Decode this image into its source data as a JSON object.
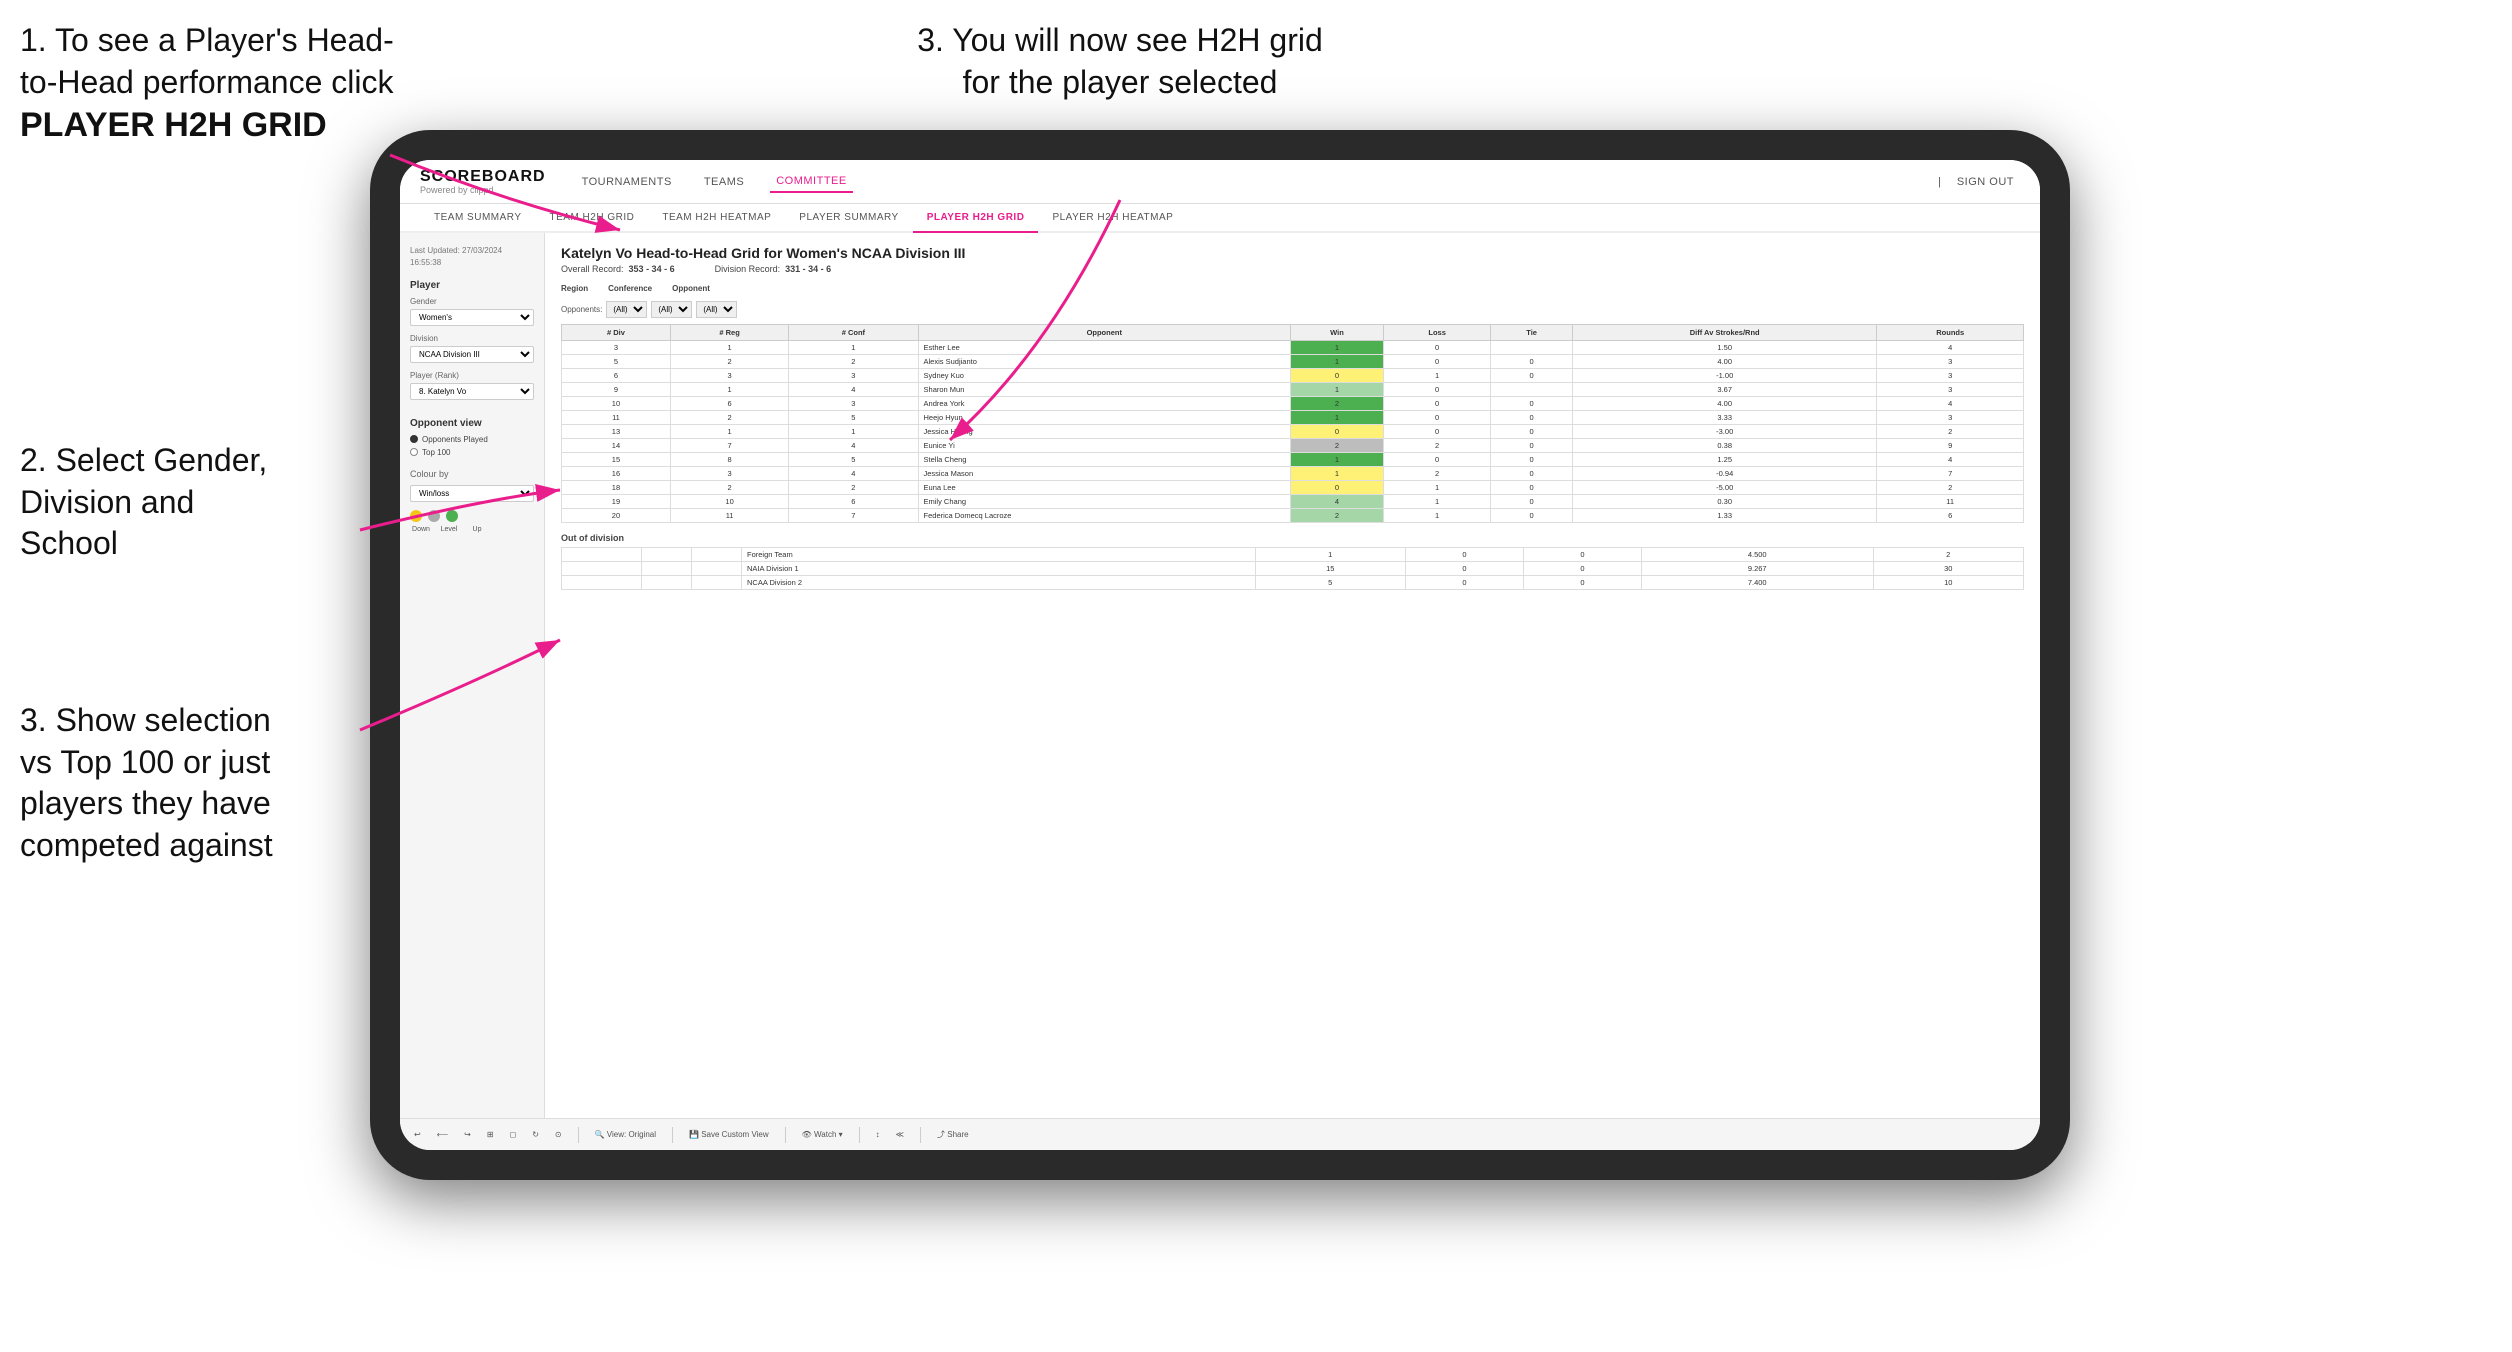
{
  "instructions": {
    "top_left_line1": "1. To see a Player's Head-",
    "top_left_line2": "to-Head performance click",
    "top_left_bold": "PLAYER H2H GRID",
    "top_right": "3. You will now see H2H grid\nfor the player selected",
    "mid_left_label": "2. Select Gender,\nDivision and\nSchool",
    "bottom_left_label": "3. Show selection\nvs Top 100 or just\nplayers they have\ncompeted against"
  },
  "header": {
    "logo": "SCOREBOARD",
    "logo_sub": "Powered by clippd",
    "nav": [
      "TOURNAMENTS",
      "TEAMS",
      "COMMITTEE"
    ],
    "active_nav": "COMMITTEE",
    "sign_out": "Sign out"
  },
  "sub_nav": {
    "items": [
      "TEAM SUMMARY",
      "TEAM H2H GRID",
      "TEAM H2H HEATMAP",
      "PLAYER SUMMARY",
      "PLAYER H2H GRID",
      "PLAYER H2H HEATMAP"
    ],
    "active": "PLAYER H2H GRID"
  },
  "sidebar": {
    "timestamp": "Last Updated: 27/03/2024\n16:55:38",
    "player_section": "Player",
    "gender_label": "Gender",
    "gender_value": "Women's",
    "division_label": "Division",
    "division_value": "NCAA Division III",
    "player_rank_label": "Player (Rank)",
    "player_rank_value": "8. Katelyn Vo",
    "opponent_view": "Opponent view",
    "radio_options": [
      "Opponents Played",
      "Top 100"
    ],
    "selected_radio": "Opponents Played",
    "colour_by": "Colour by",
    "colour_by_value": "Win/loss",
    "colour_labels": [
      "Down",
      "Level",
      "Up"
    ]
  },
  "grid": {
    "title": "Katelyn Vo Head-to-Head Grid for Women's NCAA Division III",
    "overall_record_label": "Overall Record:",
    "overall_record_value": "353 - 34 - 6",
    "division_record_label": "Division Record:",
    "division_record_value": "331 - 34 - 6",
    "region_filter_label": "Region",
    "conference_filter_label": "Conference",
    "opponent_filter_label": "Opponent",
    "opponents_label": "Opponents:",
    "filter_all": "(All)",
    "columns": [
      "# Div",
      "# Reg",
      "# Conf",
      "Opponent",
      "Win",
      "Loss",
      "Tie",
      "Diff Av Strokes/Rnd",
      "Rounds"
    ],
    "rows": [
      {
        "div": "3",
        "reg": "1",
        "conf": "1",
        "opponent": "Esther Lee",
        "win": "1",
        "loss": "0",
        "tie": "",
        "diff": "1.50",
        "rounds": "4",
        "win_color": "green"
      },
      {
        "div": "5",
        "reg": "2",
        "conf": "2",
        "opponent": "Alexis Sudjianto",
        "win": "1",
        "loss": "0",
        "tie": "0",
        "diff": "4.00",
        "rounds": "3",
        "win_color": "green"
      },
      {
        "div": "6",
        "reg": "3",
        "conf": "3",
        "opponent": "Sydney Kuo",
        "win": "0",
        "loss": "1",
        "tie": "0",
        "diff": "-1.00",
        "rounds": "3",
        "win_color": "yellow"
      },
      {
        "div": "9",
        "reg": "1",
        "conf": "4",
        "opponent": "Sharon Mun",
        "win": "1",
        "loss": "0",
        "tie": "",
        "diff": "3.67",
        "rounds": "3",
        "win_color": "light-green"
      },
      {
        "div": "10",
        "reg": "6",
        "conf": "3",
        "opponent": "Andrea York",
        "win": "2",
        "loss": "0",
        "tie": "0",
        "diff": "4.00",
        "rounds": "4",
        "win_color": "green"
      },
      {
        "div": "11",
        "reg": "2",
        "conf": "5",
        "opponent": "Heejo Hyun",
        "win": "1",
        "loss": "0",
        "tie": "0",
        "diff": "3.33",
        "rounds": "3",
        "win_color": "green"
      },
      {
        "div": "13",
        "reg": "1",
        "conf": "1",
        "opponent": "Jessica Huang",
        "win": "0",
        "loss": "0",
        "tie": "0",
        "diff": "-3.00",
        "rounds": "2",
        "win_color": "yellow"
      },
      {
        "div": "14",
        "reg": "7",
        "conf": "4",
        "opponent": "Eunice Yi",
        "win": "2",
        "loss": "2",
        "tie": "0",
        "diff": "0.38",
        "rounds": "9",
        "win_color": "gray"
      },
      {
        "div": "15",
        "reg": "8",
        "conf": "5",
        "opponent": "Stella Cheng",
        "win": "1",
        "loss": "0",
        "tie": "0",
        "diff": "1.25",
        "rounds": "4",
        "win_color": "green"
      },
      {
        "div": "16",
        "reg": "3",
        "conf": "4",
        "opponent": "Jessica Mason",
        "win": "1",
        "loss": "2",
        "tie": "0",
        "diff": "-0.94",
        "rounds": "7",
        "win_color": "yellow"
      },
      {
        "div": "18",
        "reg": "2",
        "conf": "2",
        "opponent": "Euna Lee",
        "win": "0",
        "loss": "1",
        "tie": "0",
        "diff": "-5.00",
        "rounds": "2",
        "win_color": "yellow"
      },
      {
        "div": "19",
        "reg": "10",
        "conf": "6",
        "opponent": "Emily Chang",
        "win": "4",
        "loss": "1",
        "tie": "0",
        "diff": "0.30",
        "rounds": "11",
        "win_color": "light-green"
      },
      {
        "div": "20",
        "reg": "11",
        "conf": "7",
        "opponent": "Federica Domecq Lacroze",
        "win": "2",
        "loss": "1",
        "tie": "0",
        "diff": "1.33",
        "rounds": "6",
        "win_color": "light-green"
      }
    ],
    "out_of_division_label": "Out of division",
    "out_of_division_rows": [
      {
        "label": "Foreign Team",
        "win": "1",
        "loss": "0",
        "tie": "0",
        "diff": "4.500",
        "rounds": "2"
      },
      {
        "label": "NAIA Division 1",
        "win": "15",
        "loss": "0",
        "tie": "0",
        "diff": "9.267",
        "rounds": "30"
      },
      {
        "label": "NCAA Division 2",
        "win": "5",
        "loss": "0",
        "tie": "0",
        "diff": "7.400",
        "rounds": "10"
      }
    ]
  },
  "toolbar": {
    "buttons": [
      "↩",
      "⟵",
      "↪",
      "⊞",
      "◻·",
      "↻",
      "⊙",
      "View: Original",
      "Save Custom View",
      "Watch ▾",
      "↕",
      "≪",
      "Share"
    ]
  }
}
